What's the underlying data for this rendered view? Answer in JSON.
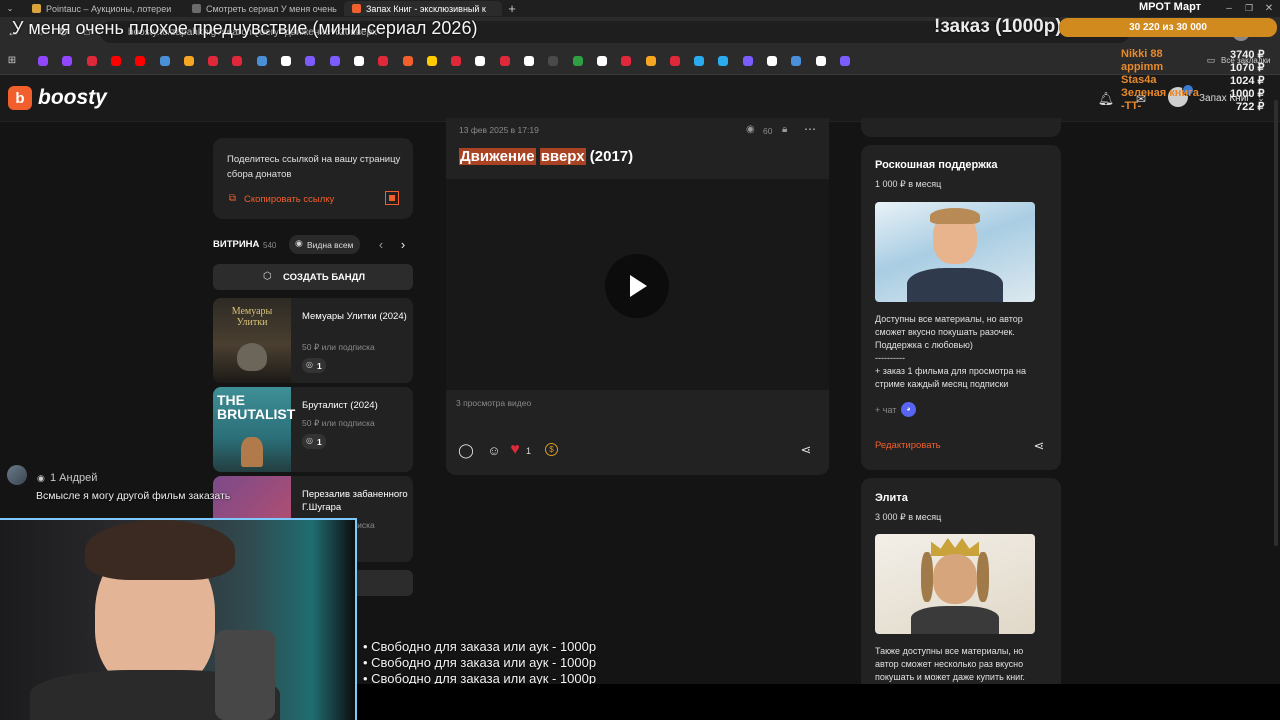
{
  "tabs": [
    {
      "title": "Pointauc – Аукционы, лотереи",
      "color": "#d9a43d"
    },
    {
      "title": "Смотреть сериал У меня очень",
      "color": "#6a6a6a"
    },
    {
      "title": "Запах Книг - эксклюзивный к",
      "color": "#f15f2c"
    }
  ],
  "stream_title": "У меня очень плохое предчувствие (мини-сериал 2026)",
  "address": "boosty.to/zapahknig?searchQuery=движение%20вверх",
  "overlay": {
    "order_label": "!заказ (1000р)",
    "goal_name": "МРОТ Март",
    "goal_progress_text": "30 220  из 30 000",
    "goal_progress": 1.0,
    "donors": [
      {
        "name": "Nikki 88",
        "amount": "3740 ₽"
      },
      {
        "name": "appimm",
        "amount": "1070 ₽"
      },
      {
        "name": "Stas4a",
        "amount": "1024 ₽"
      },
      {
        "name": "Зеленая книга",
        "amount": "1000 ₽"
      },
      {
        "name": "-TT-",
        "amount": "722 ₽"
      }
    ],
    "free_lines": [
      "• Свободно для заказа или аук - 1000р",
      "• Свободно для заказа или аук - 1000р",
      "• Свободно для заказа или аук - 1000р"
    ],
    "chat_user": "1 Андрей",
    "chat_message": "Всмысле я могу другой фильм заказать"
  },
  "bookmarks_label": "Все закладки",
  "site": {
    "logo": "boosty",
    "user_name": "Запах Книг"
  },
  "share": {
    "text": "Поделитесь ссылкой на вашу страницу сбора донатов",
    "copy_label": "Скопировать ссылку"
  },
  "showcase": {
    "title": "ВИТРИНА",
    "count": "540",
    "visibility": "Видна всем",
    "bundle_button": "СОЗДАТЬ БАНДЛ",
    "items": [
      {
        "title": "Мемуары Улитки (2024)",
        "price": "50 ₽ или подписка",
        "count": "1",
        "poster_text": "Мемуары Улитки"
      },
      {
        "title": "Бруталист (2024)",
        "price": "50 ₽ или подписка",
        "count": "1",
        "poster_text": "THE BRUTALIST"
      },
      {
        "title": "Перезалив забаненного Г.Шугара",
        "price": "50 ₽ или подписка",
        "count": "",
        "poster_text": ""
      }
    ]
  },
  "post": {
    "date": "13 фев 2025 в 17:19",
    "views": "60",
    "title_hl1": "Движение",
    "title_hl2": "вверх",
    "title_rest": "(2017)",
    "video_views": "3 просмотра видео",
    "likes": "1"
  },
  "tiers": [
    {
      "name": "Роскошная поддержка",
      "price": "1 000 ₽ в месяц",
      "desc": [
        "Доступны все материалы, но автор",
        "сможет вкусно покушать разочек.",
        "Поддержка с любовью)",
        "----------",
        "+ заказ 1 фильма для просмотра на",
        "стриме каждый месяц подписки"
      ],
      "chat_label": "+ чат",
      "edit_label": "Редактировать"
    },
    {
      "name": "Элита",
      "price": "3 000 ₽ в месяц",
      "desc": [
        "Также доступны все материалы, но",
        "автор сможет несколько раз вкусно",
        "покушать и может даже купить книг."
      ]
    }
  ],
  "colors": {
    "accent": "#f15f2c",
    "card": "#222222",
    "page": "#141414",
    "highlight": "#a94323",
    "donor": "#e8892c"
  }
}
